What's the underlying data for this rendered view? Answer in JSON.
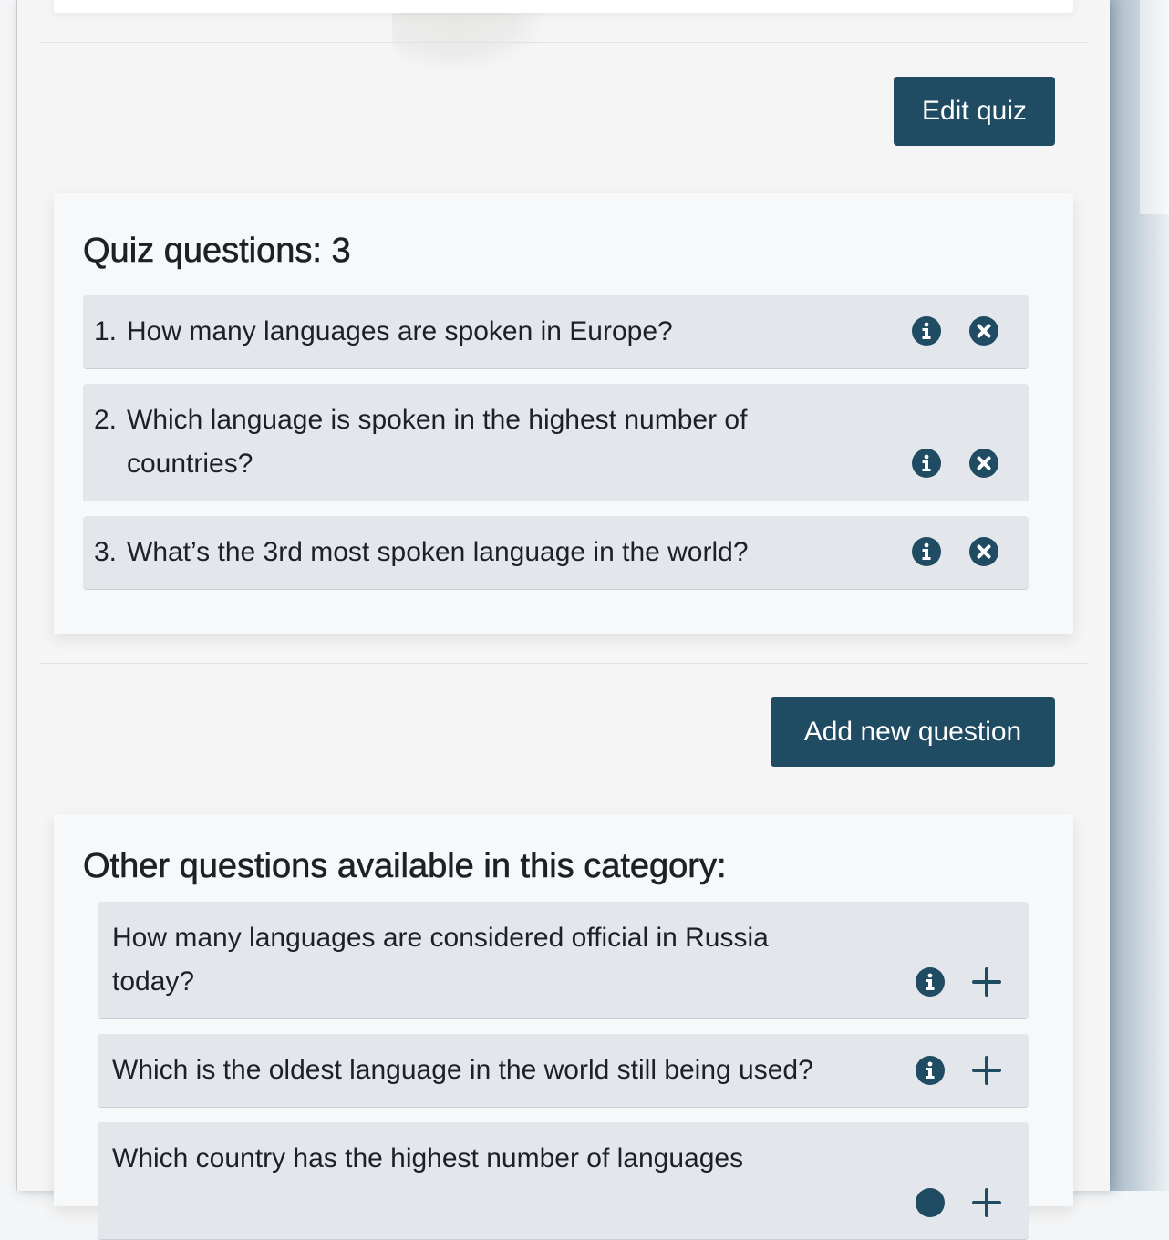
{
  "buttons": {
    "edit_quiz": "Edit quiz",
    "add_new_question": "Add new question"
  },
  "quiz_questions": {
    "heading": "Quiz questions: 3",
    "items": [
      {
        "number": "1.",
        "line1": "How many languages are spoken in Europe?",
        "line2": ""
      },
      {
        "number": "2.",
        "line1": "Which language is spoken in the highest number of",
        "line2": "countries?"
      },
      {
        "number": "3.",
        "line1": "What’s the 3rd most spoken language in the world?",
        "line2": ""
      }
    ]
  },
  "other_questions": {
    "heading": "Other questions available in this category:",
    "items": [
      {
        "line1": "How many languages are considered official in Russia",
        "line2": "today?"
      },
      {
        "line1": "Which is the oldest language in the world still being used?",
        "line2": ""
      },
      {
        "line1": "Which country has the highest number of languages",
        "line2": ""
      }
    ]
  },
  "icons": {
    "info": "info-circle-icon",
    "remove": "x-circle-icon",
    "add": "plus-icon"
  },
  "colors": {
    "primary": "#1f4b63",
    "item_bg": "#e3e7eb",
    "card_bg": "#f7f8f9"
  }
}
